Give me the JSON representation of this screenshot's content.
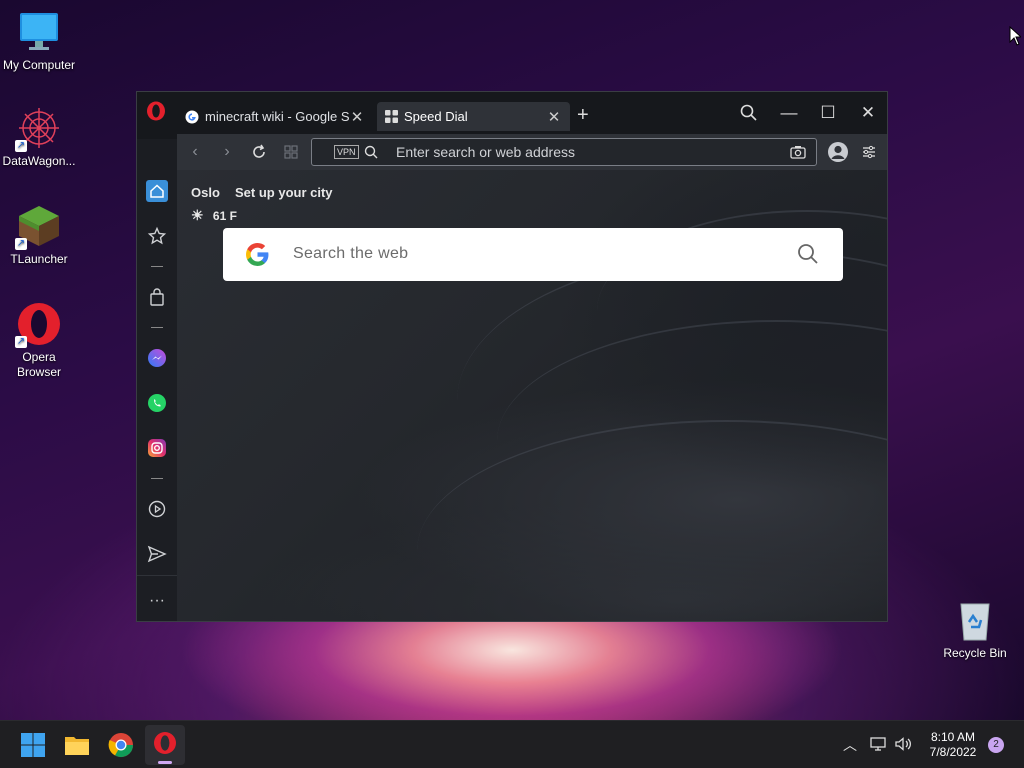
{
  "desktop": {
    "icons": [
      {
        "label": "My Computer",
        "icon": "monitor-icon"
      },
      {
        "label": "DataWagon...",
        "icon": "mandala-icon"
      },
      {
        "label": "TLauncher",
        "icon": "grass-block-icon"
      },
      {
        "label": "Opera Browser",
        "icon": "opera-icon"
      },
      {
        "label": "Recycle Bin",
        "icon": "recycle-bin-icon"
      }
    ]
  },
  "browser": {
    "tabs": [
      {
        "label": "minecraft wiki - Google Search",
        "icon": "google-icon"
      },
      {
        "label": "Speed Dial",
        "icon": "speed-dial-icon"
      }
    ],
    "address": {
      "vpn_label": "VPN",
      "placeholder": "Enter search or web address"
    },
    "speed_dial": {
      "city": "Oslo",
      "setup_city": "Set up your city",
      "temperature": "61 F",
      "search_placeholder": "Search the web"
    },
    "sidebar": [
      "home-icon",
      "bookmarks-icon",
      "shopping-bag-icon",
      "messenger-icon",
      "whatsapp-icon",
      "instagram-icon",
      "player-icon",
      "send-icon",
      "more-icon"
    ]
  },
  "taskbar": {
    "time": "8:10 AM",
    "date": "7/8/2022",
    "notification_count": "2"
  },
  "colors": {
    "opera_red": "#e3202c",
    "accent": "#3a8fd8"
  }
}
